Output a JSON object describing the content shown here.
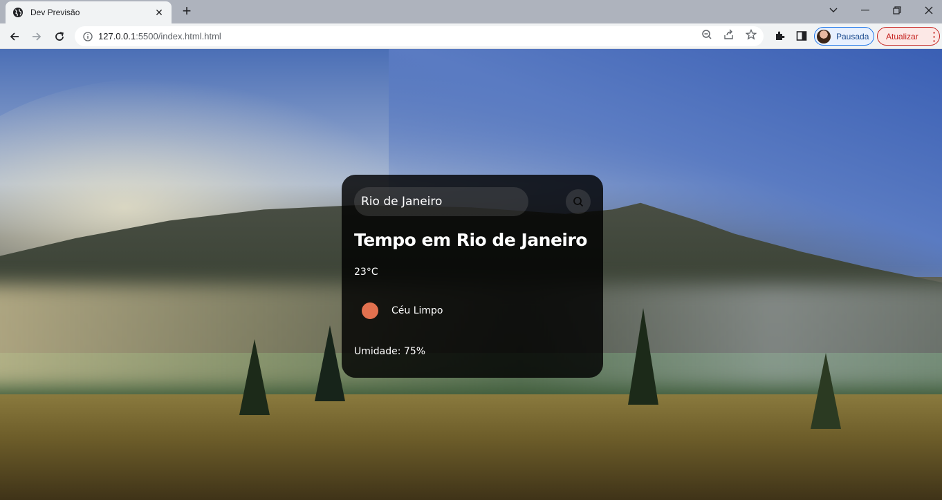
{
  "browser": {
    "tab_title": "Dev Previsão",
    "url_host": "127.0.0.1",
    "url_rest": ":5500/index.html.html",
    "profile_label": "Pausada",
    "update_label": "Atualizar"
  },
  "weather": {
    "search_value": "Rio de Janeiro",
    "city_heading": "Tempo em Rio de Janeiro",
    "temperature": "23°C",
    "description": "Céu Limpo",
    "humidity": "Umidade: 75%",
    "icon_color": "#e2714f"
  }
}
